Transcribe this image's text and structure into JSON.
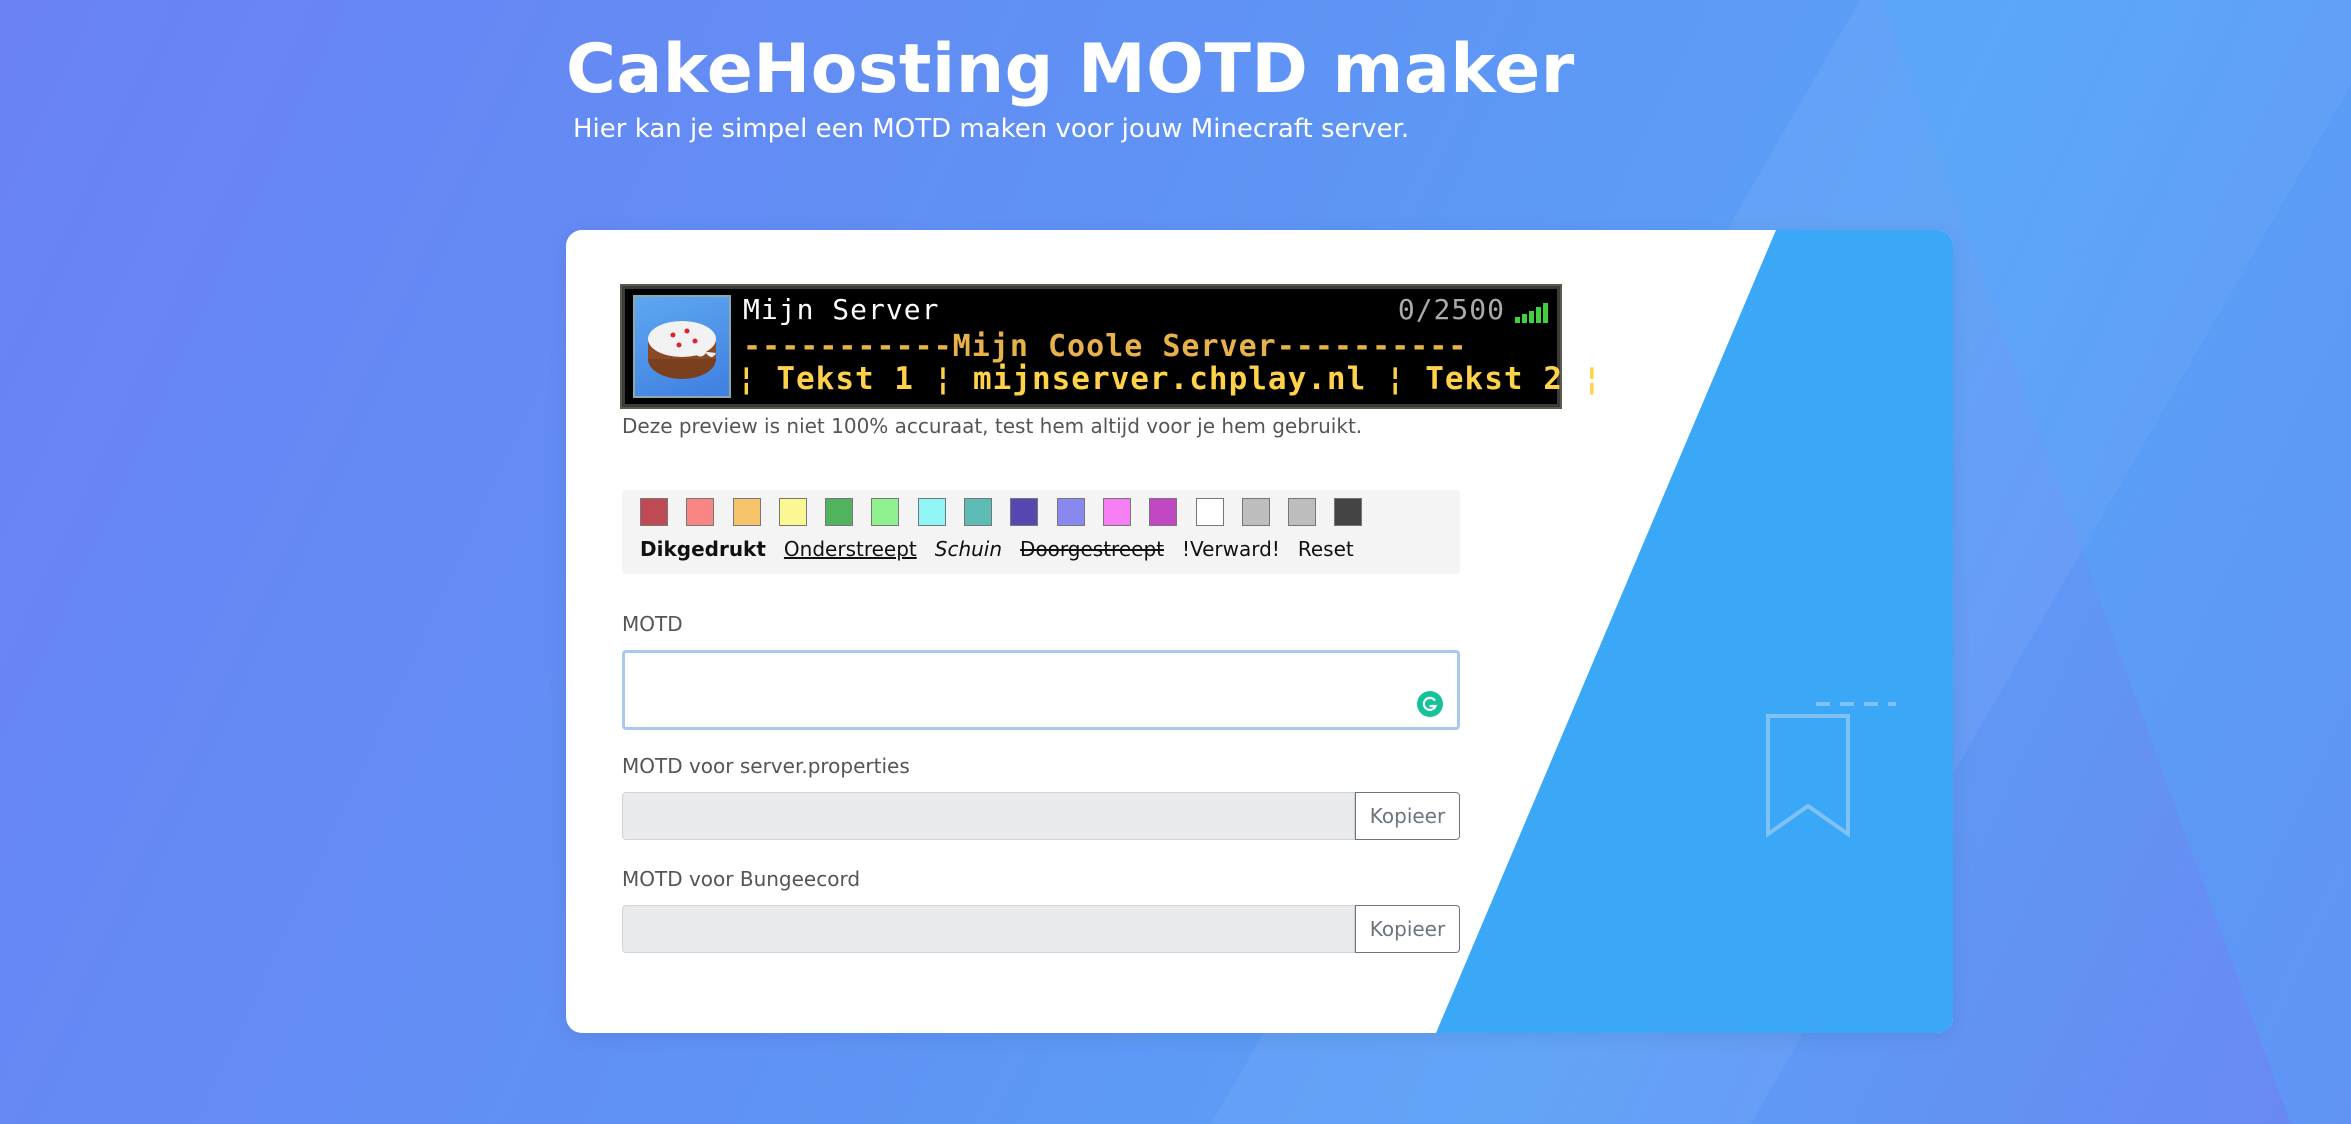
{
  "header": {
    "title": "CakeHosting MOTD maker",
    "subtitle": "Hier kan je simpel een MOTD maken voor jouw Minecraft server."
  },
  "preview": {
    "server_name": "Mijn Server",
    "players": "0/2500",
    "line1": "-----------Mijn Coole Server----------",
    "line2": "¦ Tekst 1 ¦ mijnserver.chplay.nl ¦ Tekst 2 ¦",
    "icon": "cake-icon",
    "note": "Deze preview is niet 100% accuraat, test hem altijd voor je hem gebruikt."
  },
  "toolbar": {
    "colors": [
      "#be4a55",
      "#f98585",
      "#f7c36b",
      "#fbf792",
      "#52b35f",
      "#8ff28f",
      "#8ff5f5",
      "#5ebcb6",
      "#5348b1",
      "#8888ef",
      "#f57ef5",
      "#c048c0",
      "#ffffff",
      "#bdbdbd",
      "#bdbdbd",
      "#444444"
    ],
    "bold": "Dikgedrukt",
    "underline": "Onderstreept",
    "italic": "Schuin",
    "strike": "Doorgestreept",
    "obfuscated": "!Verward!",
    "reset": "Reset"
  },
  "form": {
    "motd_label": "MOTD",
    "motd_value": "",
    "server_properties_label": "MOTD voor server.properties",
    "bungeecord_label": "MOTD voor Bungeecord",
    "copy_label": "Kopieer"
  },
  "decor": {
    "bookmark_icon": "bookmark-icon",
    "grammarly_icon": "grammarly-icon"
  }
}
